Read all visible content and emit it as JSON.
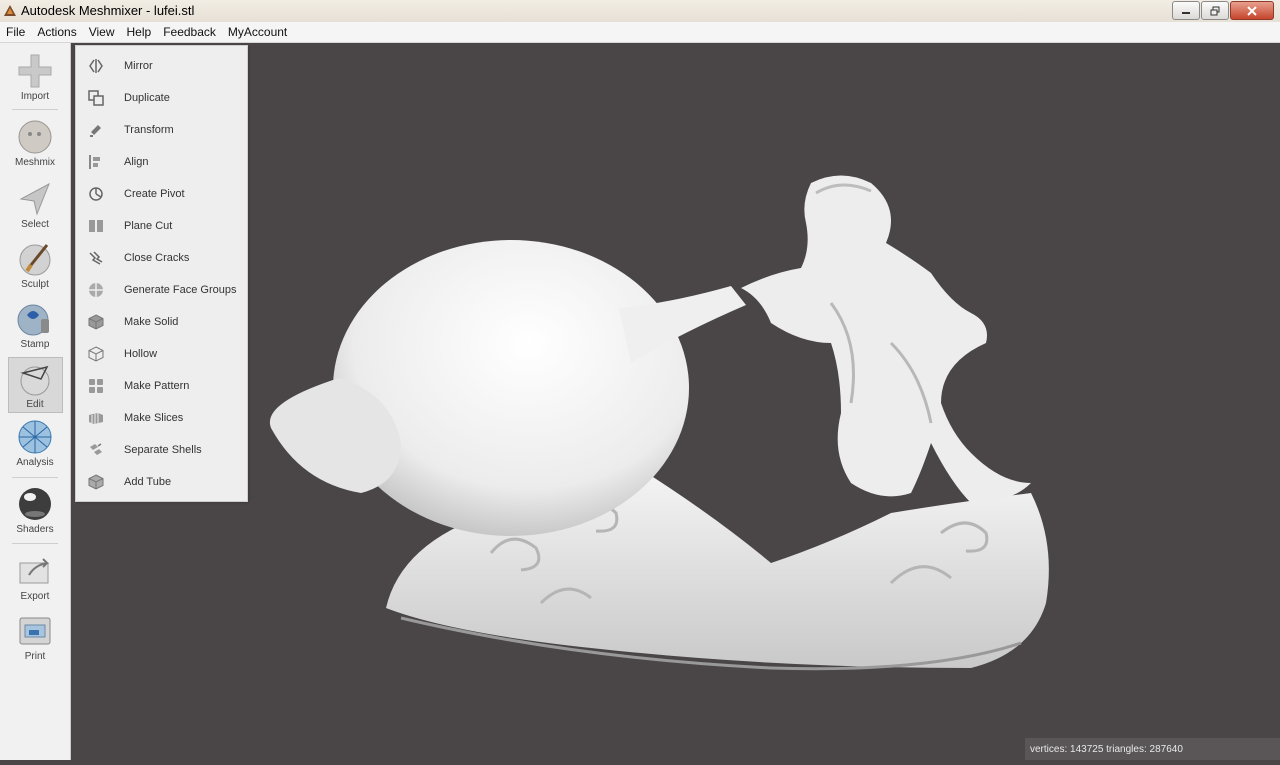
{
  "window": {
    "title": "Autodesk Meshmixer - lufei.stl"
  },
  "menubar": {
    "items": [
      "File",
      "Actions",
      "View",
      "Help",
      "Feedback",
      "MyAccount"
    ]
  },
  "toolbar": {
    "tools": [
      {
        "label": "Import",
        "icon": "plus-icon"
      },
      {
        "label": "Meshmix",
        "icon": "meshmix-ball-icon"
      },
      {
        "label": "Select",
        "icon": "select-arrow-icon"
      },
      {
        "label": "Sculpt",
        "icon": "sculpt-brush-icon"
      },
      {
        "label": "Stamp",
        "icon": "stamp-icon"
      },
      {
        "label": "Edit",
        "icon": "edit-sphere-icon",
        "active": true
      },
      {
        "label": "Analysis",
        "icon": "analysis-mesh-icon"
      },
      {
        "label": "Shaders",
        "icon": "shader-sphere-icon"
      },
      {
        "label": "Export",
        "icon": "export-icon"
      },
      {
        "label": "Print",
        "icon": "printer-icon"
      }
    ]
  },
  "edit_menu": {
    "items": [
      {
        "label": "Mirror",
        "icon": "mirror-icon"
      },
      {
        "label": "Duplicate",
        "icon": "duplicate-icon"
      },
      {
        "label": "Transform",
        "icon": "transform-icon"
      },
      {
        "label": "Align",
        "icon": "align-icon"
      },
      {
        "label": "Create Pivot",
        "icon": "pivot-icon"
      },
      {
        "label": "Plane Cut",
        "icon": "plane-cut-icon"
      },
      {
        "label": "Close Cracks",
        "icon": "close-cracks-icon"
      },
      {
        "label": "Generate Face Groups",
        "icon": "face-groups-icon"
      },
      {
        "label": "Make Solid",
        "icon": "make-solid-icon"
      },
      {
        "label": "Hollow",
        "icon": "hollow-icon"
      },
      {
        "label": "Make Pattern",
        "icon": "pattern-icon"
      },
      {
        "label": "Make Slices",
        "icon": "slices-icon"
      },
      {
        "label": "Separate Shells",
        "icon": "shells-icon"
      },
      {
        "label": "Add Tube",
        "icon": "tube-icon"
      }
    ]
  },
  "status": {
    "text": "vertices: 143725 triangles: 287640"
  },
  "colors": {
    "viewport_bg": "#4a4647",
    "model": "#f2f2f2"
  }
}
